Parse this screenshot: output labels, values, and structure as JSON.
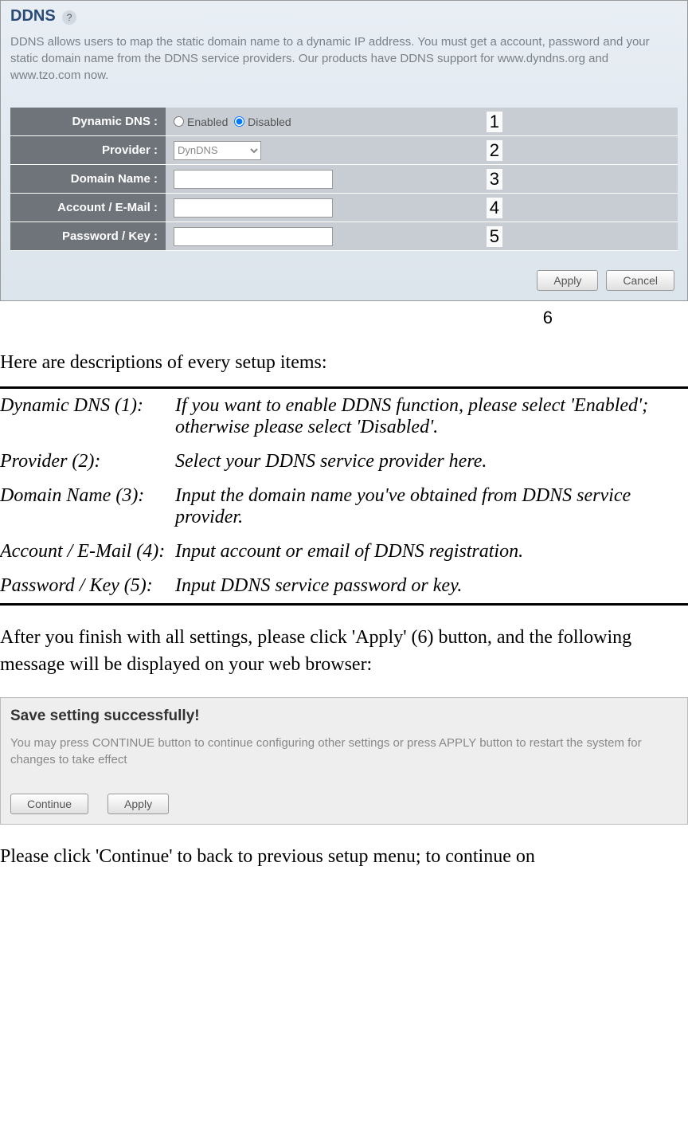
{
  "ddns_panel": {
    "title": "DDNS",
    "help_icon": "?",
    "intro": "DDNS allows users to map the static domain name to a dynamic IP address. You must get a account, password and your static domain name from the DDNS service providers. Our products have DDNS support for www.dyndns.org and www.tzo.com now.",
    "rows": [
      {
        "label": "Dynamic DNS :",
        "badge": "1",
        "type": "radio",
        "enabled": "Enabled",
        "disabled": "Disabled"
      },
      {
        "label": "Provider :",
        "badge": "2",
        "type": "select",
        "value": "DynDNS"
      },
      {
        "label": "Domain Name :",
        "badge": "3",
        "type": "text"
      },
      {
        "label": "Account / E-Mail :",
        "badge": "4",
        "type": "text"
      },
      {
        "label": "Password / Key :",
        "badge": "5",
        "type": "text"
      }
    ],
    "apply_button": "Apply",
    "cancel_button": "Cancel",
    "badge6": "6"
  },
  "desc_intro": "Here are descriptions of every setup items:",
  "descriptions": [
    {
      "label": "Dynamic DNS (1):",
      "text": "If you want to enable DDNS function, please select 'Enabled'; otherwise please select 'Disabled'."
    },
    {
      "label": "Provider (2):",
      "text": "Select your DDNS service provider here."
    },
    {
      "label": "Domain Name (3):",
      "text": "Input the domain name you've obtained from DDNS service provider."
    },
    {
      "label": "Account / E-Mail (4):",
      "text": "Input account or email of DDNS registration."
    },
    {
      "label": "Password / Key (5):",
      "text": "Input DDNS service password or key."
    }
  ],
  "after_text": "After you finish with all settings, please click 'Apply' (6) button, and the following message will be displayed on your web browser:",
  "save_panel": {
    "title": "Save setting successfully!",
    "text": "You may press CONTINUE button to continue configuring other settings or press APPLY button to restart the system for changes to take effect",
    "continue_button": "Continue",
    "apply_button": "Apply"
  },
  "footer_text": "Please click 'Continue' to back to previous setup menu; to continue on"
}
